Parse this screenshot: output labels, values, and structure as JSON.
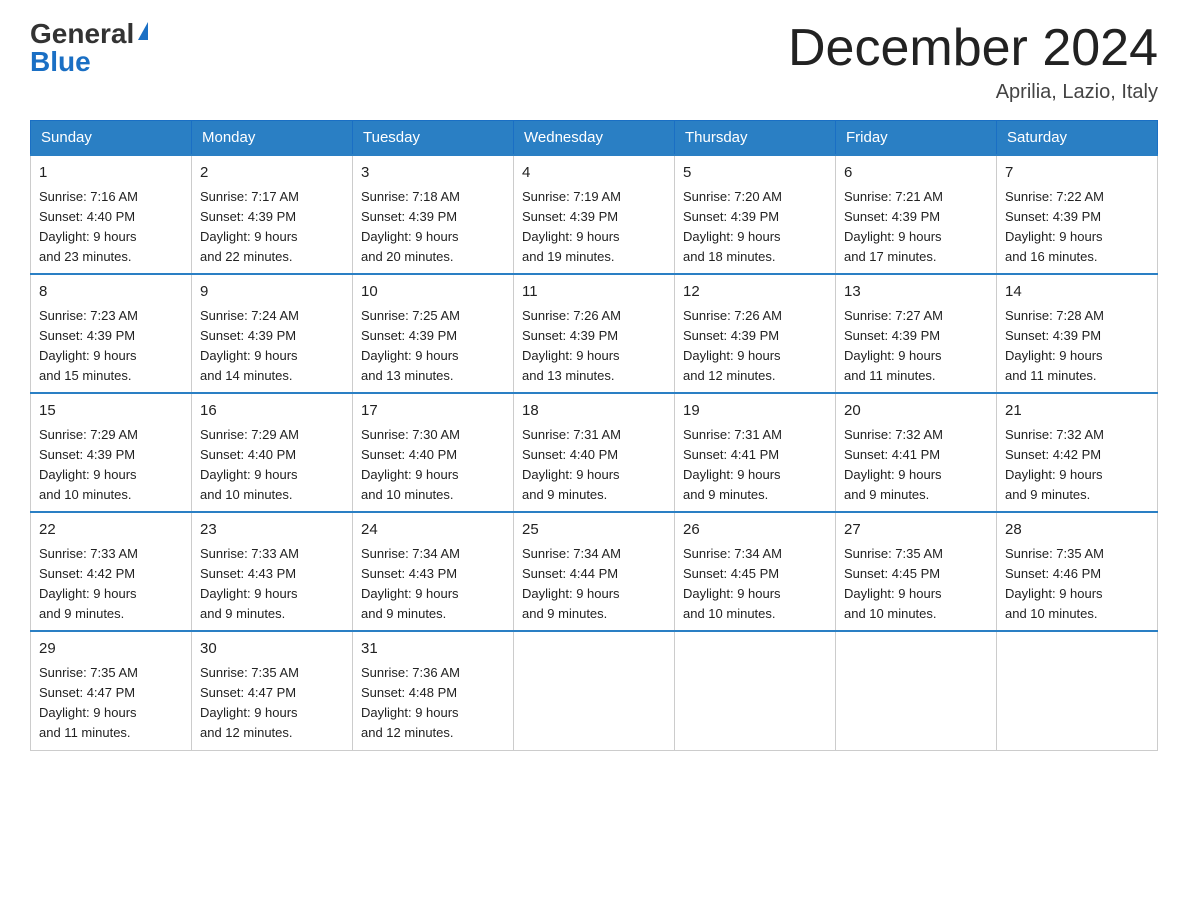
{
  "header": {
    "logo_general": "General",
    "logo_blue": "Blue",
    "month_title": "December 2024",
    "location": "Aprilia, Lazio, Italy"
  },
  "days_of_week": [
    "Sunday",
    "Monday",
    "Tuesday",
    "Wednesday",
    "Thursday",
    "Friday",
    "Saturday"
  ],
  "weeks": [
    [
      {
        "day": "1",
        "sunrise": "7:16 AM",
        "sunset": "4:40 PM",
        "daylight": "9 hours and 23 minutes."
      },
      {
        "day": "2",
        "sunrise": "7:17 AM",
        "sunset": "4:39 PM",
        "daylight": "9 hours and 22 minutes."
      },
      {
        "day": "3",
        "sunrise": "7:18 AM",
        "sunset": "4:39 PM",
        "daylight": "9 hours and 20 minutes."
      },
      {
        "day": "4",
        "sunrise": "7:19 AM",
        "sunset": "4:39 PM",
        "daylight": "9 hours and 19 minutes."
      },
      {
        "day": "5",
        "sunrise": "7:20 AM",
        "sunset": "4:39 PM",
        "daylight": "9 hours and 18 minutes."
      },
      {
        "day": "6",
        "sunrise": "7:21 AM",
        "sunset": "4:39 PM",
        "daylight": "9 hours and 17 minutes."
      },
      {
        "day": "7",
        "sunrise": "7:22 AM",
        "sunset": "4:39 PM",
        "daylight": "9 hours and 16 minutes."
      }
    ],
    [
      {
        "day": "8",
        "sunrise": "7:23 AM",
        "sunset": "4:39 PM",
        "daylight": "9 hours and 15 minutes."
      },
      {
        "day": "9",
        "sunrise": "7:24 AM",
        "sunset": "4:39 PM",
        "daylight": "9 hours and 14 minutes."
      },
      {
        "day": "10",
        "sunrise": "7:25 AM",
        "sunset": "4:39 PM",
        "daylight": "9 hours and 13 minutes."
      },
      {
        "day": "11",
        "sunrise": "7:26 AM",
        "sunset": "4:39 PM",
        "daylight": "9 hours and 13 minutes."
      },
      {
        "day": "12",
        "sunrise": "7:26 AM",
        "sunset": "4:39 PM",
        "daylight": "9 hours and 12 minutes."
      },
      {
        "day": "13",
        "sunrise": "7:27 AM",
        "sunset": "4:39 PM",
        "daylight": "9 hours and 11 minutes."
      },
      {
        "day": "14",
        "sunrise": "7:28 AM",
        "sunset": "4:39 PM",
        "daylight": "9 hours and 11 minutes."
      }
    ],
    [
      {
        "day": "15",
        "sunrise": "7:29 AM",
        "sunset": "4:39 PM",
        "daylight": "9 hours and 10 minutes."
      },
      {
        "day": "16",
        "sunrise": "7:29 AM",
        "sunset": "4:40 PM",
        "daylight": "9 hours and 10 minutes."
      },
      {
        "day": "17",
        "sunrise": "7:30 AM",
        "sunset": "4:40 PM",
        "daylight": "9 hours and 10 minutes."
      },
      {
        "day": "18",
        "sunrise": "7:31 AM",
        "sunset": "4:40 PM",
        "daylight": "9 hours and 9 minutes."
      },
      {
        "day": "19",
        "sunrise": "7:31 AM",
        "sunset": "4:41 PM",
        "daylight": "9 hours and 9 minutes."
      },
      {
        "day": "20",
        "sunrise": "7:32 AM",
        "sunset": "4:41 PM",
        "daylight": "9 hours and 9 minutes."
      },
      {
        "day": "21",
        "sunrise": "7:32 AM",
        "sunset": "4:42 PM",
        "daylight": "9 hours and 9 minutes."
      }
    ],
    [
      {
        "day": "22",
        "sunrise": "7:33 AM",
        "sunset": "4:42 PM",
        "daylight": "9 hours and 9 minutes."
      },
      {
        "day": "23",
        "sunrise": "7:33 AM",
        "sunset": "4:43 PM",
        "daylight": "9 hours and 9 minutes."
      },
      {
        "day": "24",
        "sunrise": "7:34 AM",
        "sunset": "4:43 PM",
        "daylight": "9 hours and 9 minutes."
      },
      {
        "day": "25",
        "sunrise": "7:34 AM",
        "sunset": "4:44 PM",
        "daylight": "9 hours and 9 minutes."
      },
      {
        "day": "26",
        "sunrise": "7:34 AM",
        "sunset": "4:45 PM",
        "daylight": "9 hours and 10 minutes."
      },
      {
        "day": "27",
        "sunrise": "7:35 AM",
        "sunset": "4:45 PM",
        "daylight": "9 hours and 10 minutes."
      },
      {
        "day": "28",
        "sunrise": "7:35 AM",
        "sunset": "4:46 PM",
        "daylight": "9 hours and 10 minutes."
      }
    ],
    [
      {
        "day": "29",
        "sunrise": "7:35 AM",
        "sunset": "4:47 PM",
        "daylight": "9 hours and 11 minutes."
      },
      {
        "day": "30",
        "sunrise": "7:35 AM",
        "sunset": "4:47 PM",
        "daylight": "9 hours and 12 minutes."
      },
      {
        "day": "31",
        "sunrise": "7:36 AM",
        "sunset": "4:48 PM",
        "daylight": "9 hours and 12 minutes."
      },
      null,
      null,
      null,
      null
    ]
  ],
  "labels": {
    "sunrise_prefix": "Sunrise: ",
    "sunset_prefix": "Sunset: ",
    "daylight_prefix": "Daylight: "
  }
}
